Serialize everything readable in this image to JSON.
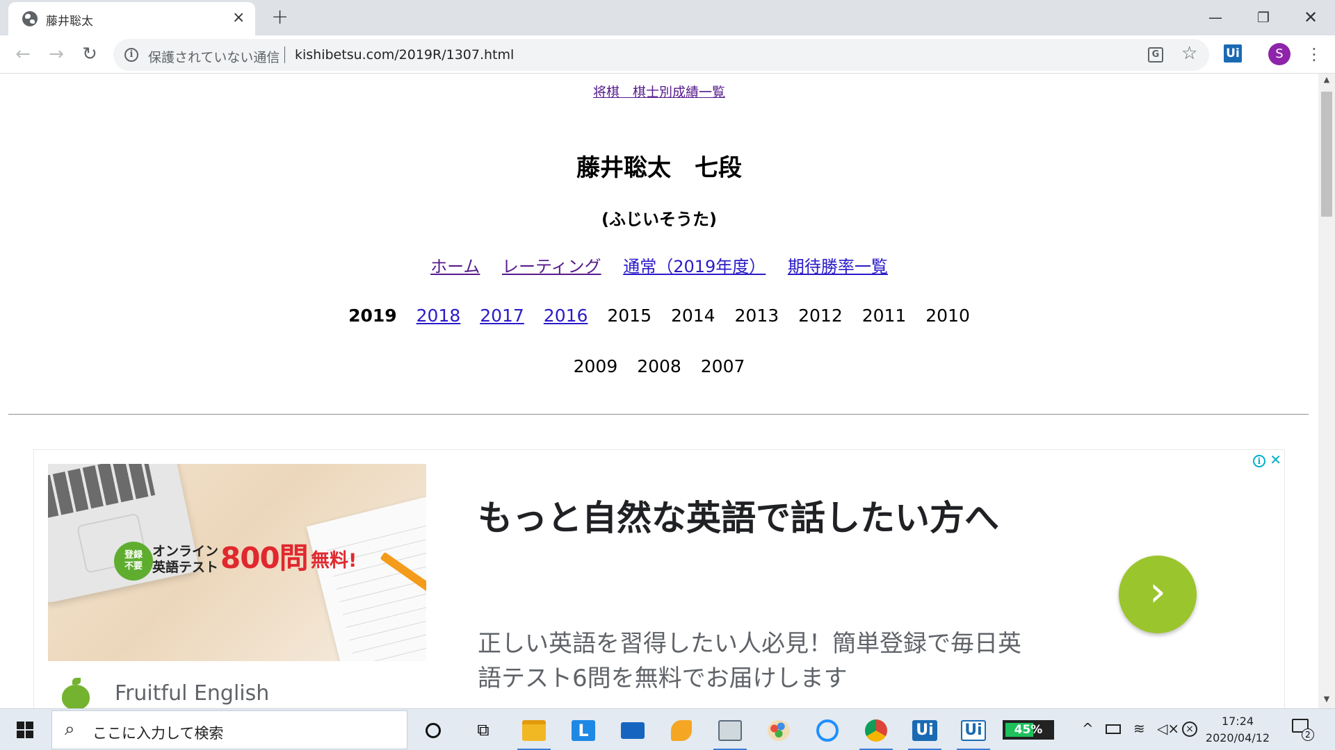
{
  "browser": {
    "tab_title": "藤井聡太",
    "tab_close": "×",
    "new_tab": "+",
    "win_minimize": "—",
    "win_restore": "❐",
    "win_close": "✕",
    "back": "←",
    "forward": "→",
    "reload": "↻",
    "security_icon": "i",
    "security_text": "保護されていない通信",
    "url": "kishibetsu.com/2019R/1307.html",
    "translate_icon": "G",
    "star": "☆",
    "extension_label": "Ui",
    "profile_initial": "S",
    "menu": "⋮"
  },
  "page": {
    "site_link": "将棋　棋士別成績一覧",
    "player_name": "藤井聡太　七段",
    "player_kana": "(ふじいそうた)",
    "nav_links": [
      "ホーム",
      "レーティング",
      "通常（2019年度）",
      "期待勝率一覧"
    ],
    "years_row1": [
      "2019",
      "2018",
      "2017",
      "2016",
      "2015",
      "2014",
      "2013",
      "2012",
      "2011",
      "2010"
    ],
    "years_row2": [
      "2009",
      "2008",
      "2007"
    ]
  },
  "ad": {
    "badge": "登録\n不要",
    "image_line1": "オンライン",
    "image_line2": "英語テスト",
    "image_big": "800問",
    "image_free": "無料!",
    "headline": "もっと自然な英語で話したい方へ",
    "description": "正しい英語を習得したい人必見！簡単登録で毎日英語テスト6問を無料でお届けします",
    "brand": "Fruitful English",
    "info_icon": "i",
    "close_icon": "✕",
    "arrow": "›"
  },
  "scrollbar": {
    "up": "▲",
    "down": "▼"
  },
  "taskbar": {
    "search_icon": "⌕",
    "search_placeholder": "ここに入力して検索",
    "taskview": "⧉",
    "battery_percent": "45%",
    "tray_chevron": "^",
    "time": "17:24",
    "date": "2020/04/12",
    "notification_count": "2",
    "icons": [
      {
        "name": "file-explorer-icon",
        "color": "#f2b824"
      },
      {
        "name": "l-app-icon",
        "color": "#1e88e5",
        "label": "L"
      },
      {
        "name": "mail-icon",
        "color": "#1565c0"
      },
      {
        "name": "fox-app-icon",
        "color": "#f5a623"
      },
      {
        "name": "notepad-pen-icon",
        "color": "#5b6b7c"
      },
      {
        "name": "paint-icon",
        "color": "#e94e3c"
      },
      {
        "name": "internet-explorer-icon",
        "color": "#1e90ff"
      },
      {
        "name": "chrome-icon",
        "color": "#db4437"
      },
      {
        "name": "uipath-studio-icon",
        "color": "#1a6ab3",
        "label": "Ui"
      },
      {
        "name": "uipath-robot-icon",
        "color": "#ffffff",
        "label": "Ui"
      }
    ]
  }
}
